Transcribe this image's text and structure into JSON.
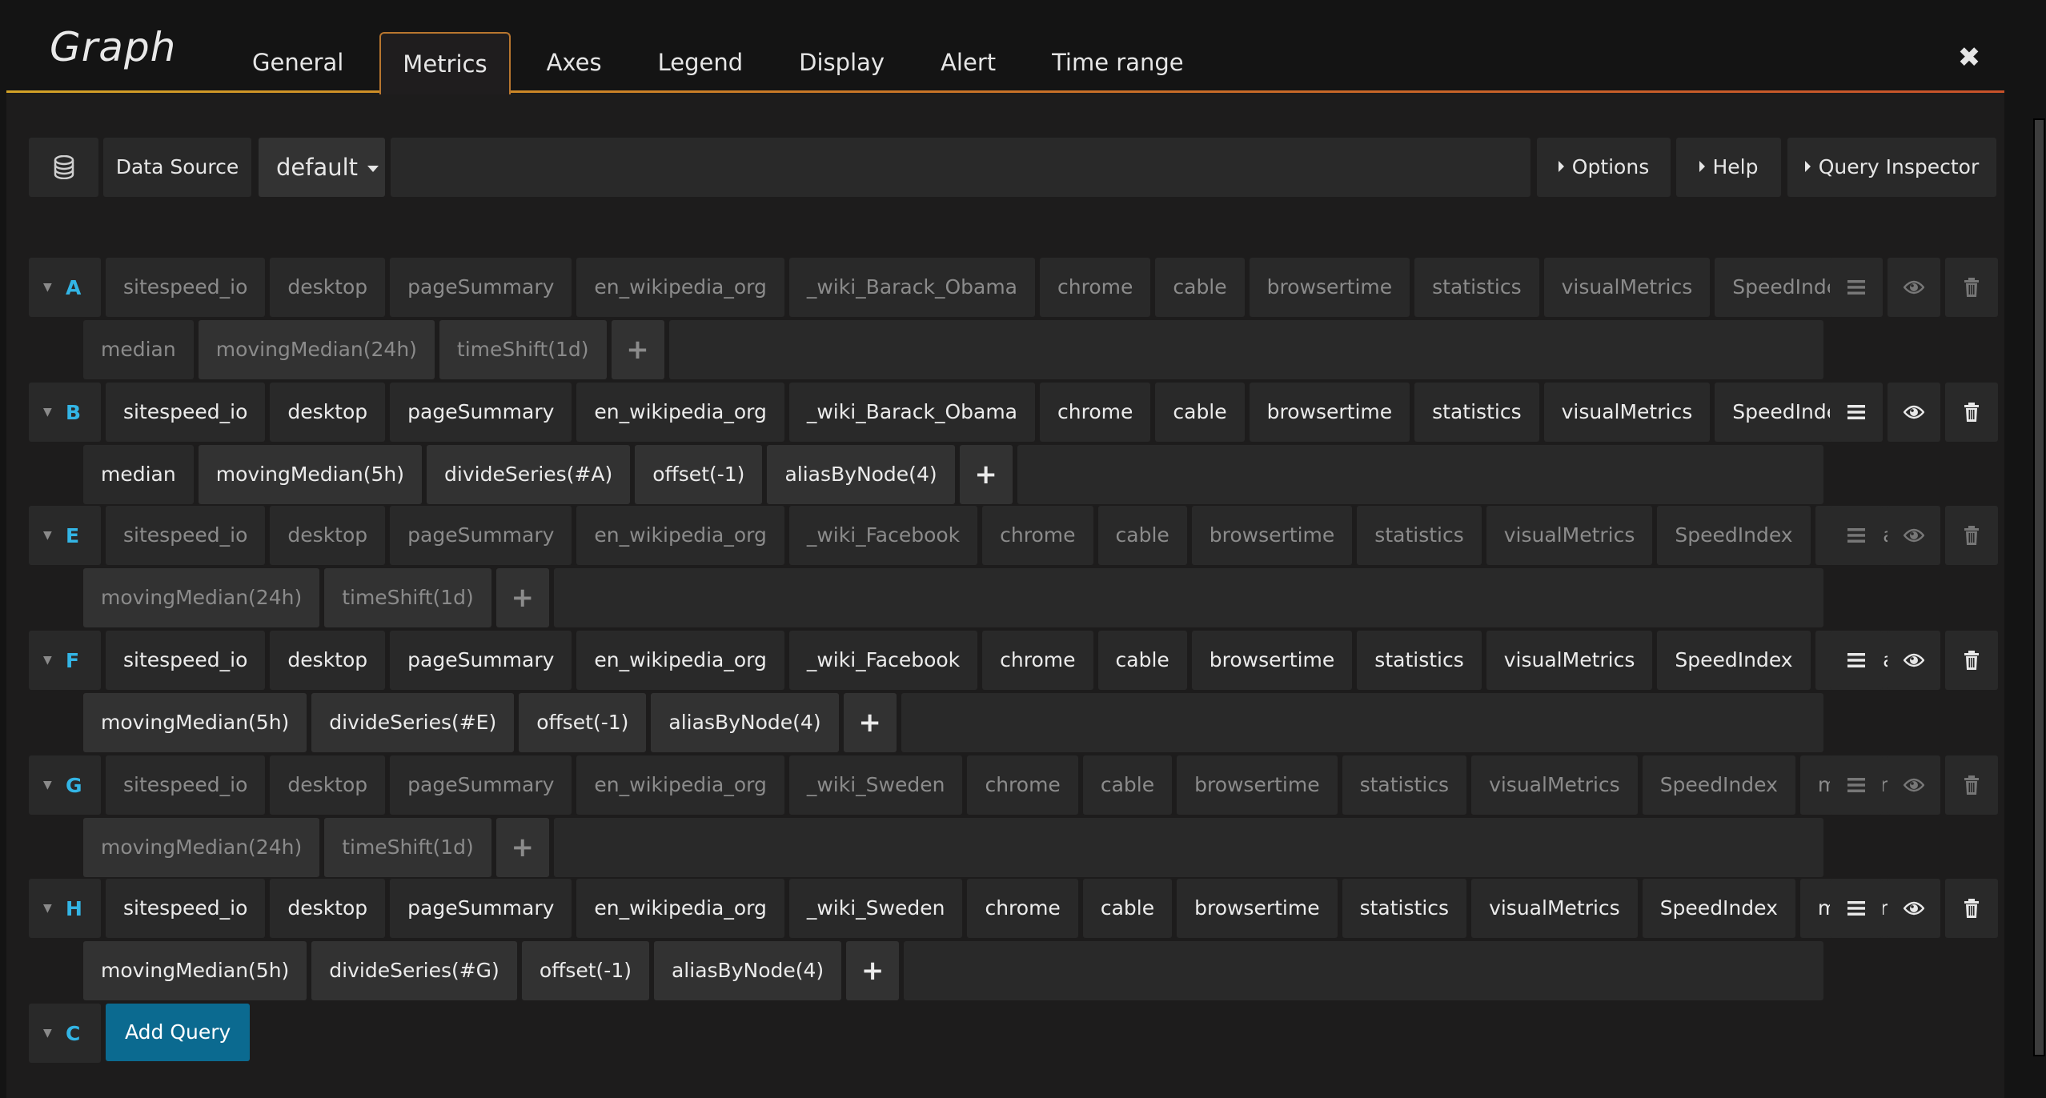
{
  "header": {
    "title": "Graph",
    "tabs": [
      {
        "label": "General",
        "active": false
      },
      {
        "label": "Metrics",
        "active": true
      },
      {
        "label": "Axes",
        "active": false
      },
      {
        "label": "Legend",
        "active": false
      },
      {
        "label": "Display",
        "active": false
      },
      {
        "label": "Alert",
        "active": false
      },
      {
        "label": "Time range",
        "active": false
      }
    ],
    "close_icon": "close-icon"
  },
  "toolbar": {
    "datasource_icon": "database-icon",
    "datasource_label": "Data Source",
    "datasource_value": "default",
    "options_label": "Options",
    "help_label": "Help",
    "query_inspector_label": "Query Inspector"
  },
  "queries": [
    {
      "ref": "A",
      "disabled": true,
      "segments": [
        "sitespeed_io",
        "desktop",
        "pageSummary",
        "en_wikipedia_org",
        "_wiki_Barack_Obama",
        "chrome",
        "cable",
        "browsertime",
        "statistics",
        "visualMetrics",
        "SpeedIndex"
      ],
      "functions": [
        "median",
        "movingMedian(24h)",
        "timeShift(1d)"
      ]
    },
    {
      "ref": "B",
      "disabled": false,
      "segments": [
        "sitespeed_io",
        "desktop",
        "pageSummary",
        "en_wikipedia_org",
        "_wiki_Barack_Obama",
        "chrome",
        "cable",
        "browsertime",
        "statistics",
        "visualMetrics",
        "SpeedIndex"
      ],
      "functions": [
        "median",
        "movingMedian(5h)",
        "divideSeries(#A)",
        "offset(-1)",
        "aliasByNode(4)"
      ]
    },
    {
      "ref": "E",
      "disabled": true,
      "segments": [
        "sitespeed_io",
        "desktop",
        "pageSummary",
        "en_wikipedia_org",
        "_wiki_Facebook",
        "chrome",
        "cable",
        "browsertime",
        "statistics",
        "visualMetrics",
        "SpeedIndex",
        "median"
      ],
      "functions": [
        "movingMedian(24h)",
        "timeShift(1d)"
      ]
    },
    {
      "ref": "F",
      "disabled": false,
      "segments": [
        "sitespeed_io",
        "desktop",
        "pageSummary",
        "en_wikipedia_org",
        "_wiki_Facebook",
        "chrome",
        "cable",
        "browsertime",
        "statistics",
        "visualMetrics",
        "SpeedIndex",
        "median"
      ],
      "functions": [
        "movingMedian(5h)",
        "divideSeries(#E)",
        "offset(-1)",
        "aliasByNode(4)"
      ]
    },
    {
      "ref": "G",
      "disabled": true,
      "segments": [
        "sitespeed_io",
        "desktop",
        "pageSummary",
        "en_wikipedia_org",
        "_wiki_Sweden",
        "chrome",
        "cable",
        "browsertime",
        "statistics",
        "visualMetrics",
        "SpeedIndex",
        "median"
      ],
      "functions": [
        "movingMedian(24h)",
        "timeShift(1d)"
      ]
    },
    {
      "ref": "H",
      "disabled": false,
      "segments": [
        "sitespeed_io",
        "desktop",
        "pageSummary",
        "en_wikipedia_org",
        "_wiki_Sweden",
        "chrome",
        "cable",
        "browsertime",
        "statistics",
        "visualMetrics",
        "SpeedIndex",
        "median"
      ],
      "functions": [
        "movingMedian(5h)",
        "divideSeries(#G)",
        "offset(-1)",
        "aliasByNode(4)"
      ]
    }
  ],
  "add_query": {
    "ref": "C",
    "label": "Add Query"
  },
  "add_function_label": "+",
  "row_icons": [
    "menu-icon",
    "eye-icon",
    "trash-icon"
  ],
  "colors": {
    "accent_blue": "#33b5e5",
    "tab_border": "#b8762f",
    "add_query_bg": "#0b6a90"
  }
}
